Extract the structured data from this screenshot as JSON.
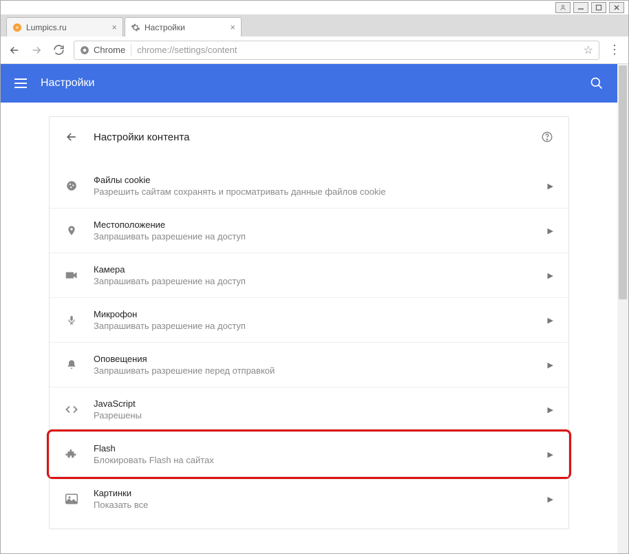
{
  "tabs": [
    {
      "title": "Lumpics.ru"
    },
    {
      "title": "Настройки"
    }
  ],
  "omnibox": {
    "origin": "Chrome",
    "url": "chrome://settings/content"
  },
  "appbar": {
    "title": "Настройки"
  },
  "card": {
    "title": "Настройки контента"
  },
  "rows": [
    {
      "title": "Файлы cookie",
      "sub": "Разрешить сайтам сохранять и просматривать данные файлов cookie"
    },
    {
      "title": "Местоположение",
      "sub": "Запрашивать разрешение на доступ"
    },
    {
      "title": "Камера",
      "sub": "Запрашивать разрешение на доступ"
    },
    {
      "title": "Микрофон",
      "sub": "Запрашивать разрешение на доступ"
    },
    {
      "title": "Оповещения",
      "sub": "Запрашивать разрешение перед отправкой"
    },
    {
      "title": "JavaScript",
      "sub": "Разрешены"
    },
    {
      "title": "Flash",
      "sub": "Блокировать Flash на сайтах"
    },
    {
      "title": "Картинки",
      "sub": "Показать все"
    }
  ]
}
